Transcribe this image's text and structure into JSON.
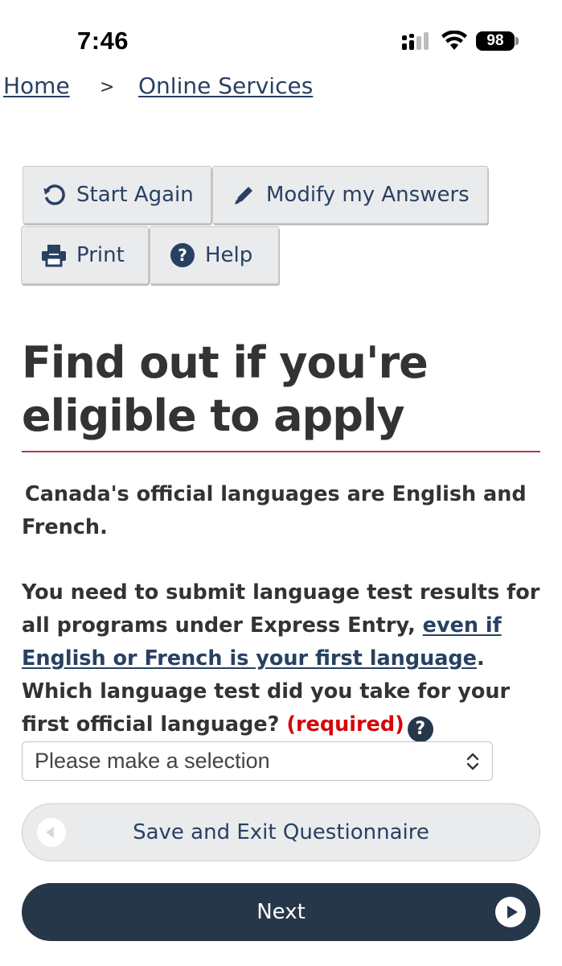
{
  "status_bar": {
    "time": "7:46",
    "battery": "98"
  },
  "breadcrumb": {
    "home": "Home",
    "separator": ">",
    "online_services": "Online Services"
  },
  "toolbar": {
    "start_again": "Start Again",
    "modify_answers": "Modify my Answers",
    "print": "Print",
    "help": "Help"
  },
  "page": {
    "title_line1": "Find out if you're",
    "title_line2": "eligible to apply",
    "para1": "Canada's official languages are English and French.",
    "para2_before_link": "You need to submit language test results for all programs under Express Entry, ",
    "para2_link": "even if English or French is your first language",
    "para2_after_link": ".",
    "question": "Which language test did you take for your first official language?",
    "required": "(required)",
    "help_glyph": "?"
  },
  "select": {
    "value": "Please make a selection"
  },
  "actions": {
    "save_exit": "Save and Exit Questionnaire",
    "next": "Next"
  },
  "colors": {
    "link": "#284162",
    "primary_button": "#26374a",
    "required": "#d3080c",
    "rule": "#af3c43"
  }
}
